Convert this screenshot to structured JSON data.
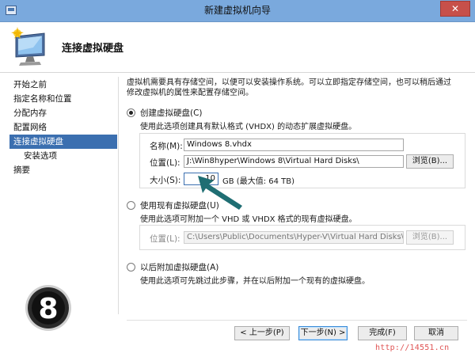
{
  "window": {
    "title": "新建虚拟机向导",
    "close_label": "✕"
  },
  "header": {
    "title": "连接虚拟硬盘"
  },
  "sidebar": {
    "items": [
      {
        "label": "开始之前"
      },
      {
        "label": "指定名称和位置"
      },
      {
        "label": "分配内存"
      },
      {
        "label": "配置网络"
      },
      {
        "label": "连接虚拟硬盘",
        "selected": true
      },
      {
        "label": "安装选项"
      },
      {
        "label": "摘要"
      }
    ]
  },
  "content": {
    "intro_line1": "虚拟机需要具有存储空间，以便可以安装操作系统。可以立即指定存储空间，也可以稍后通过",
    "intro_line2": "修改虚拟机的属性来配置存储空间。",
    "option_create": {
      "label": "创建虚拟硬盘(C)",
      "desc": "使用此选项创建具有默认格式 (VHDX) 的动态扩展虚拟硬盘。",
      "checked": true,
      "name_label": "名称(M):",
      "name_value": "Windows 8.vhdx",
      "location_label": "位置(L):",
      "location_value": "J:\\Win8hyper\\Windows 8\\Virtual Hard Disks\\",
      "browse_label": "浏览(B)...",
      "size_label": "大小(S):",
      "size_value": "10",
      "size_unit": "GB (最大值: 64 TB)"
    },
    "option_existing": {
      "label": "使用现有虚拟硬盘(U)",
      "desc": "使用此选项可附加一个 VHD 或 VHDX 格式的现有虚拟硬盘。",
      "checked": false,
      "location_label": "位置(L):",
      "location_value": "C:\\Users\\Public\\Documents\\Hyper-V\\Virtual Hard Disks\\",
      "browse_label": "浏览(B)..."
    },
    "option_later": {
      "label": "以后附加虚拟硬盘(A)",
      "desc": "使用此选项可先跳过此步骤，并在以后附加一个现有的虚拟硬盘。",
      "checked": false
    }
  },
  "footer": {
    "prev_label": "< 上一步(P)",
    "next_label": "下一步(N) >",
    "finish_label": "完成(F)",
    "cancel_label": "取消"
  },
  "badge": {
    "text": "8"
  },
  "watermark": {
    "text": "http://14551.cn"
  },
  "colors": {
    "titlebar": "#7aa9dd",
    "selected": "#3b6fb0",
    "arrow": "#1f6e73",
    "watermark": "#e05555"
  }
}
